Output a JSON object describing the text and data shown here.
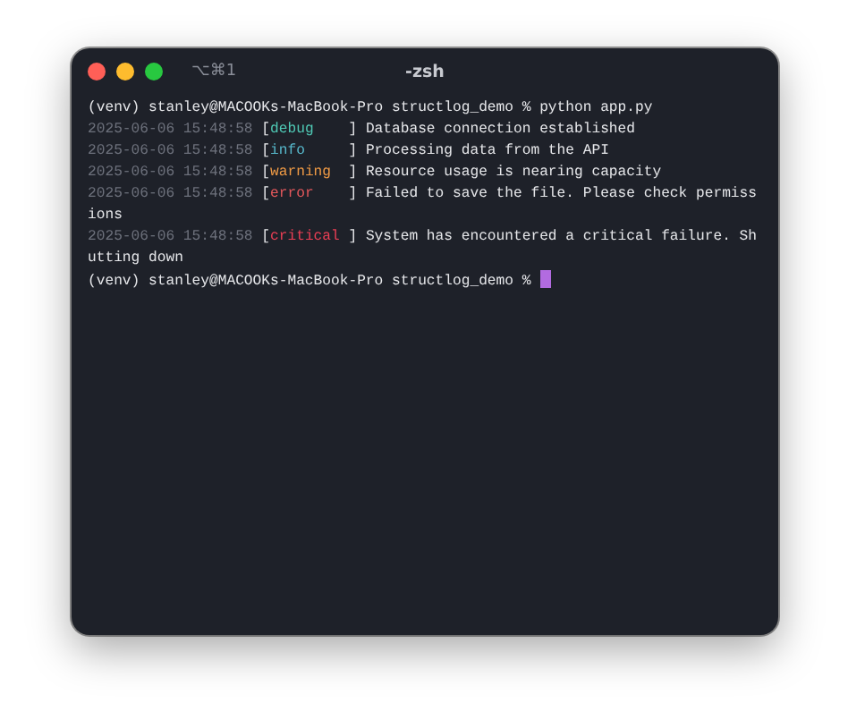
{
  "window": {
    "title": "-zsh",
    "shortcut": "⌥⌘1",
    "traffic_lights": [
      {
        "kind": "close"
      },
      {
        "kind": "minimize"
      },
      {
        "kind": "zoom"
      }
    ]
  },
  "terminal": {
    "command_line": {
      "prompt": "(venv) stanley@MACOOKs-MacBook-Pro structlog_demo %",
      "command": "python app.py"
    },
    "logs": [
      {
        "time": "2025-06-06 15:48:58",
        "open": "[",
        "level": "debug",
        "close": "]",
        "kind": "debug",
        "message": "Database connection established"
      },
      {
        "time": "2025-06-06 15:48:58",
        "open": "[",
        "level": "info",
        "close": "]",
        "kind": "info",
        "message": "Processing data from the API"
      },
      {
        "time": "2025-06-06 15:48:58",
        "open": "[",
        "level": "warning",
        "close": "]",
        "kind": "warning",
        "message": "Resource usage is nearing capacity"
      },
      {
        "time": "2025-06-06 15:48:58",
        "open": "[",
        "level": "error",
        "close": "]",
        "kind": "error",
        "message": "Failed to save the file. Please check permiss",
        "continuation": "ions"
      },
      {
        "time": "2025-06-06 15:48:58",
        "open": "[",
        "level": "critical",
        "close": "]",
        "kind": "critical",
        "message": "System has encountered a critical failure. Sh",
        "continuation": "utting down"
      }
    ],
    "final_prompt": "(venv) stanley@MACOOKs-MacBook-Pro structlog_demo %"
  }
}
